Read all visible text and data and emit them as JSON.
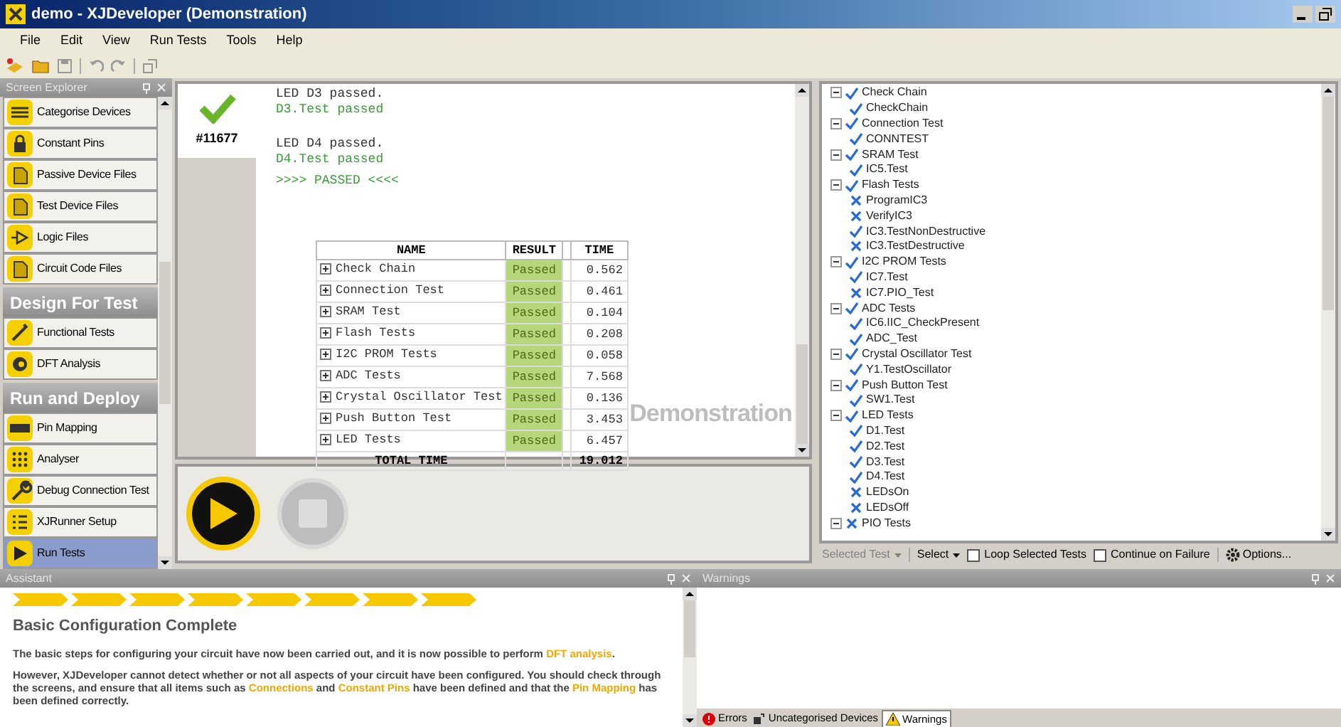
{
  "window": {
    "title": "demo - XJDeveloper (Demonstration)"
  },
  "menu": [
    "File",
    "Edit",
    "View",
    "Run Tests",
    "Tools",
    "Help"
  ],
  "sidebar": {
    "title": "Screen Explorer",
    "sections": [
      {
        "items": [
          {
            "label": "Categorise Devices",
            "selected": false
          },
          {
            "label": "Constant Pins",
            "selected": false
          },
          {
            "label": "Passive Device Files",
            "selected": false
          },
          {
            "label": "Test Device Files",
            "selected": false
          },
          {
            "label": "Logic Files",
            "selected": false
          },
          {
            "label": "Circuit Code Files",
            "selected": false
          }
        ]
      },
      {
        "title": "Design For Test",
        "items": [
          {
            "label": "Functional Tests",
            "selected": false
          },
          {
            "label": "DFT Analysis",
            "selected": false
          }
        ]
      },
      {
        "title": "Run and Deploy",
        "items": [
          {
            "label": "Pin Mapping",
            "selected": false
          },
          {
            "label": "Analyser",
            "selected": false
          },
          {
            "label": "Debug Connection Test",
            "selected": false
          },
          {
            "label": "XJRunner Setup",
            "selected": false
          },
          {
            "label": "Run Tests",
            "selected": true
          }
        ]
      }
    ]
  },
  "run_tab": {
    "label": "#11677"
  },
  "log": [
    {
      "text": "LED D3 passed.",
      "kind": "plain"
    },
    {
      "text": "D3.Test passed",
      "kind": "pass"
    },
    {
      "text": "LED D4 passed.",
      "kind": "plain"
    },
    {
      "text": "D4.Test passed",
      "kind": "pass"
    },
    {
      "text": ">>>> PASSED <<<<",
      "kind": "result"
    }
  ],
  "results_table": {
    "columns": [
      "NAME",
      "RESULT",
      "TIME"
    ],
    "rows": [
      {
        "name": "Check Chain",
        "result": "Passed",
        "time": "0.562"
      },
      {
        "name": "Connection Test",
        "result": "Passed",
        "time": "0.461"
      },
      {
        "name": "SRAM Test",
        "result": "Passed",
        "time": "0.104"
      },
      {
        "name": "Flash Tests",
        "result": "Passed",
        "time": "0.208"
      },
      {
        "name": "I2C PROM Tests",
        "result": "Passed",
        "time": "0.058"
      },
      {
        "name": "ADC Tests",
        "result": "Passed",
        "time": "7.568"
      },
      {
        "name": "Crystal Oscillator Test",
        "result": "Passed",
        "time": "0.136"
      },
      {
        "name": "Push Button Test",
        "result": "Passed",
        "time": "3.453"
      },
      {
        "name": "LED Tests",
        "result": "Passed",
        "time": "6.457"
      }
    ],
    "total": {
      "label": "TOTAL TIME",
      "time": "19.012"
    }
  },
  "demo_watermark": "Demonstration",
  "test_tree": [
    {
      "label": "Check Chain",
      "passed": true,
      "children": [
        {
          "label": "CheckChain",
          "passed": true
        }
      ]
    },
    {
      "label": "Connection Test",
      "passed": true,
      "children": [
        {
          "label": "CONNTEST",
          "passed": true
        }
      ]
    },
    {
      "label": "SRAM Test",
      "passed": true,
      "children": [
        {
          "label": "IC5.Test",
          "passed": true
        }
      ]
    },
    {
      "label": "Flash Tests",
      "passed": true,
      "children": [
        {
          "label": "ProgramIC3",
          "passed": false
        },
        {
          "label": "VerifyIC3",
          "passed": false
        },
        {
          "label": "IC3.TestNonDestructive",
          "passed": true
        },
        {
          "label": "IC3.TestDestructive",
          "passed": false
        }
      ]
    },
    {
      "label": "I2C PROM Tests",
      "passed": true,
      "children": [
        {
          "label": "IC7.Test",
          "passed": true
        },
        {
          "label": "IC7.PIO_Test",
          "passed": false
        }
      ]
    },
    {
      "label": "ADC Tests",
      "passed": true,
      "children": [
        {
          "label": "IC6.IIC_CheckPresent",
          "passed": true
        },
        {
          "label": "ADC_Test",
          "passed": true
        }
      ]
    },
    {
      "label": "Crystal Oscillator Test",
      "passed": true,
      "children": [
        {
          "label": "Y1.TestOscillator",
          "passed": true
        }
      ]
    },
    {
      "label": "Push Button Test",
      "passed": true,
      "children": [
        {
          "label": "SW1.Test",
          "passed": true
        }
      ]
    },
    {
      "label": "LED Tests",
      "passed": true,
      "children": [
        {
          "label": "D1.Test",
          "passed": true
        },
        {
          "label": "D2.Test",
          "passed": true
        },
        {
          "label": "D3.Test",
          "passed": true
        },
        {
          "label": "D4.Test",
          "passed": true
        },
        {
          "label": "LEDsOn",
          "passed": false
        },
        {
          "label": "LEDsOff",
          "passed": false
        }
      ]
    },
    {
      "label": "PIO Tests",
      "passed": false
    }
  ],
  "tree_toolbar": {
    "selected_test": {
      "label": "Selected Test",
      "disabled": true
    },
    "select": {
      "label": "Select",
      "disabled": false
    },
    "checkboxes": [
      {
        "label": "Loop Selected Tests",
        "checked": false
      },
      {
        "label": "Continue on Failure",
        "checked": false
      }
    ],
    "options": "Options..."
  },
  "assistant": {
    "title": "Assistant",
    "heading": "Basic Configuration Complete",
    "paragraphs": [
      [
        {
          "text": "The basic steps for configuring your circuit have now been carried out, and it is now possible to perform ",
          "link": false
        },
        {
          "text": "DFT analysis",
          "link": true
        },
        {
          "text": ".",
          "link": false
        }
      ],
      [
        {
          "text": "However, XJDeveloper cannot detect whether or not all aspects of your circuit have been configured. You should check through the screens, and ensure that all items such as ",
          "link": false
        },
        {
          "text": "Connections",
          "link": true
        },
        {
          "text": " and ",
          "link": false
        },
        {
          "text": "Constant Pins",
          "link": true
        },
        {
          "text": " have been defined and that the ",
          "link": false
        },
        {
          "text": "Pin Mapping",
          "link": true
        },
        {
          "text": " has been defined correctly.",
          "link": false
        }
      ]
    ]
  },
  "warnings": {
    "title": "Warnings",
    "tabs": [
      {
        "label": "Errors",
        "selected": false
      },
      {
        "label": "Uncategorised Devices",
        "selected": false
      },
      {
        "label": "Warnings",
        "selected": true
      }
    ]
  }
}
